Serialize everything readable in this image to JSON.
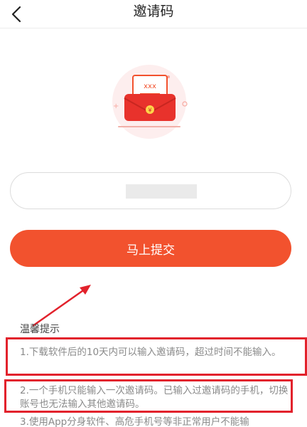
{
  "header": {
    "title": "邀请码",
    "back_icon": "back-chevron-icon"
  },
  "illustration": {
    "icon": "red-envelope-letter-icon",
    "letter_text": "xxx",
    "accent_color": "#f2522e",
    "bg_color": "#fdeeee"
  },
  "invite_input": {
    "value": "",
    "value_obscured": true
  },
  "submit_button": {
    "label": "马上提交",
    "color": "#f2522e"
  },
  "tips": {
    "title": "温馨提示",
    "items": [
      "1.下载软件后的10天内可以输入邀请码，超过时间不能输入。",
      "2.一个手机只能输入一次邀请码。已输入过邀请码的手机，切换账号也无法输入其他邀请码。",
      "3.使用App分身软件、高危手机号等非正常用户不能输"
    ]
  },
  "annotations": {
    "highlight_color": "#e2222c",
    "arrow_color": "#e2222c"
  }
}
